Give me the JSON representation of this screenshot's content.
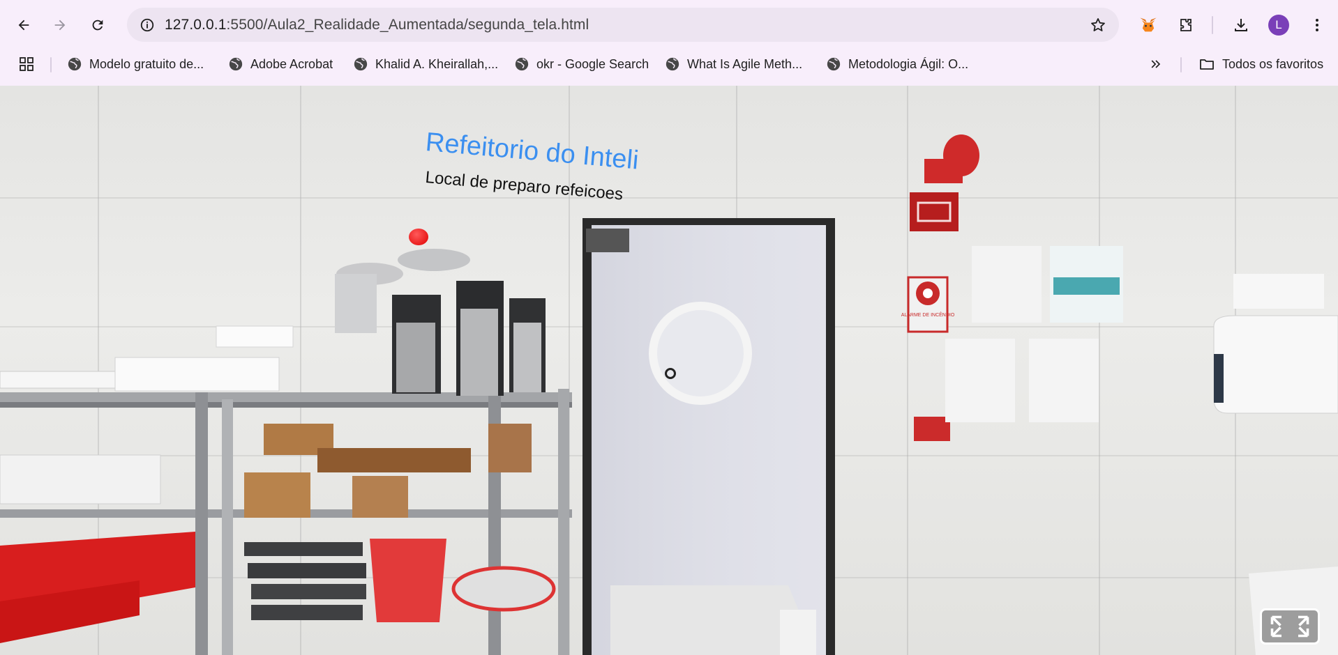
{
  "browser": {
    "url_host": "127.0.0.1",
    "url_path": ":5500/Aula2_Realidade_Aumentada/segunda_tela.html",
    "avatar_letter": "L",
    "accent": "#7a3fb8"
  },
  "bookmarks": {
    "items": [
      {
        "label": "Modelo gratuito de..."
      },
      {
        "label": "Adobe Acrobat"
      },
      {
        "label": "Khalid A. Kheirallah,..."
      },
      {
        "label": "okr - Google Search"
      },
      {
        "label": "What Is Agile Meth..."
      },
      {
        "label": "Metodologia Ágil: O..."
      }
    ],
    "all_bookmarks_label": "Todos os favoritos"
  },
  "scene": {
    "title": "Refeitorio do Inteli",
    "subtitle": "Local de preparo refeicoes",
    "title_color": "#3b8ff0",
    "sphere_color": "#e00000",
    "fire_alarm_label": "ALARME DE INCÊNDIO"
  }
}
